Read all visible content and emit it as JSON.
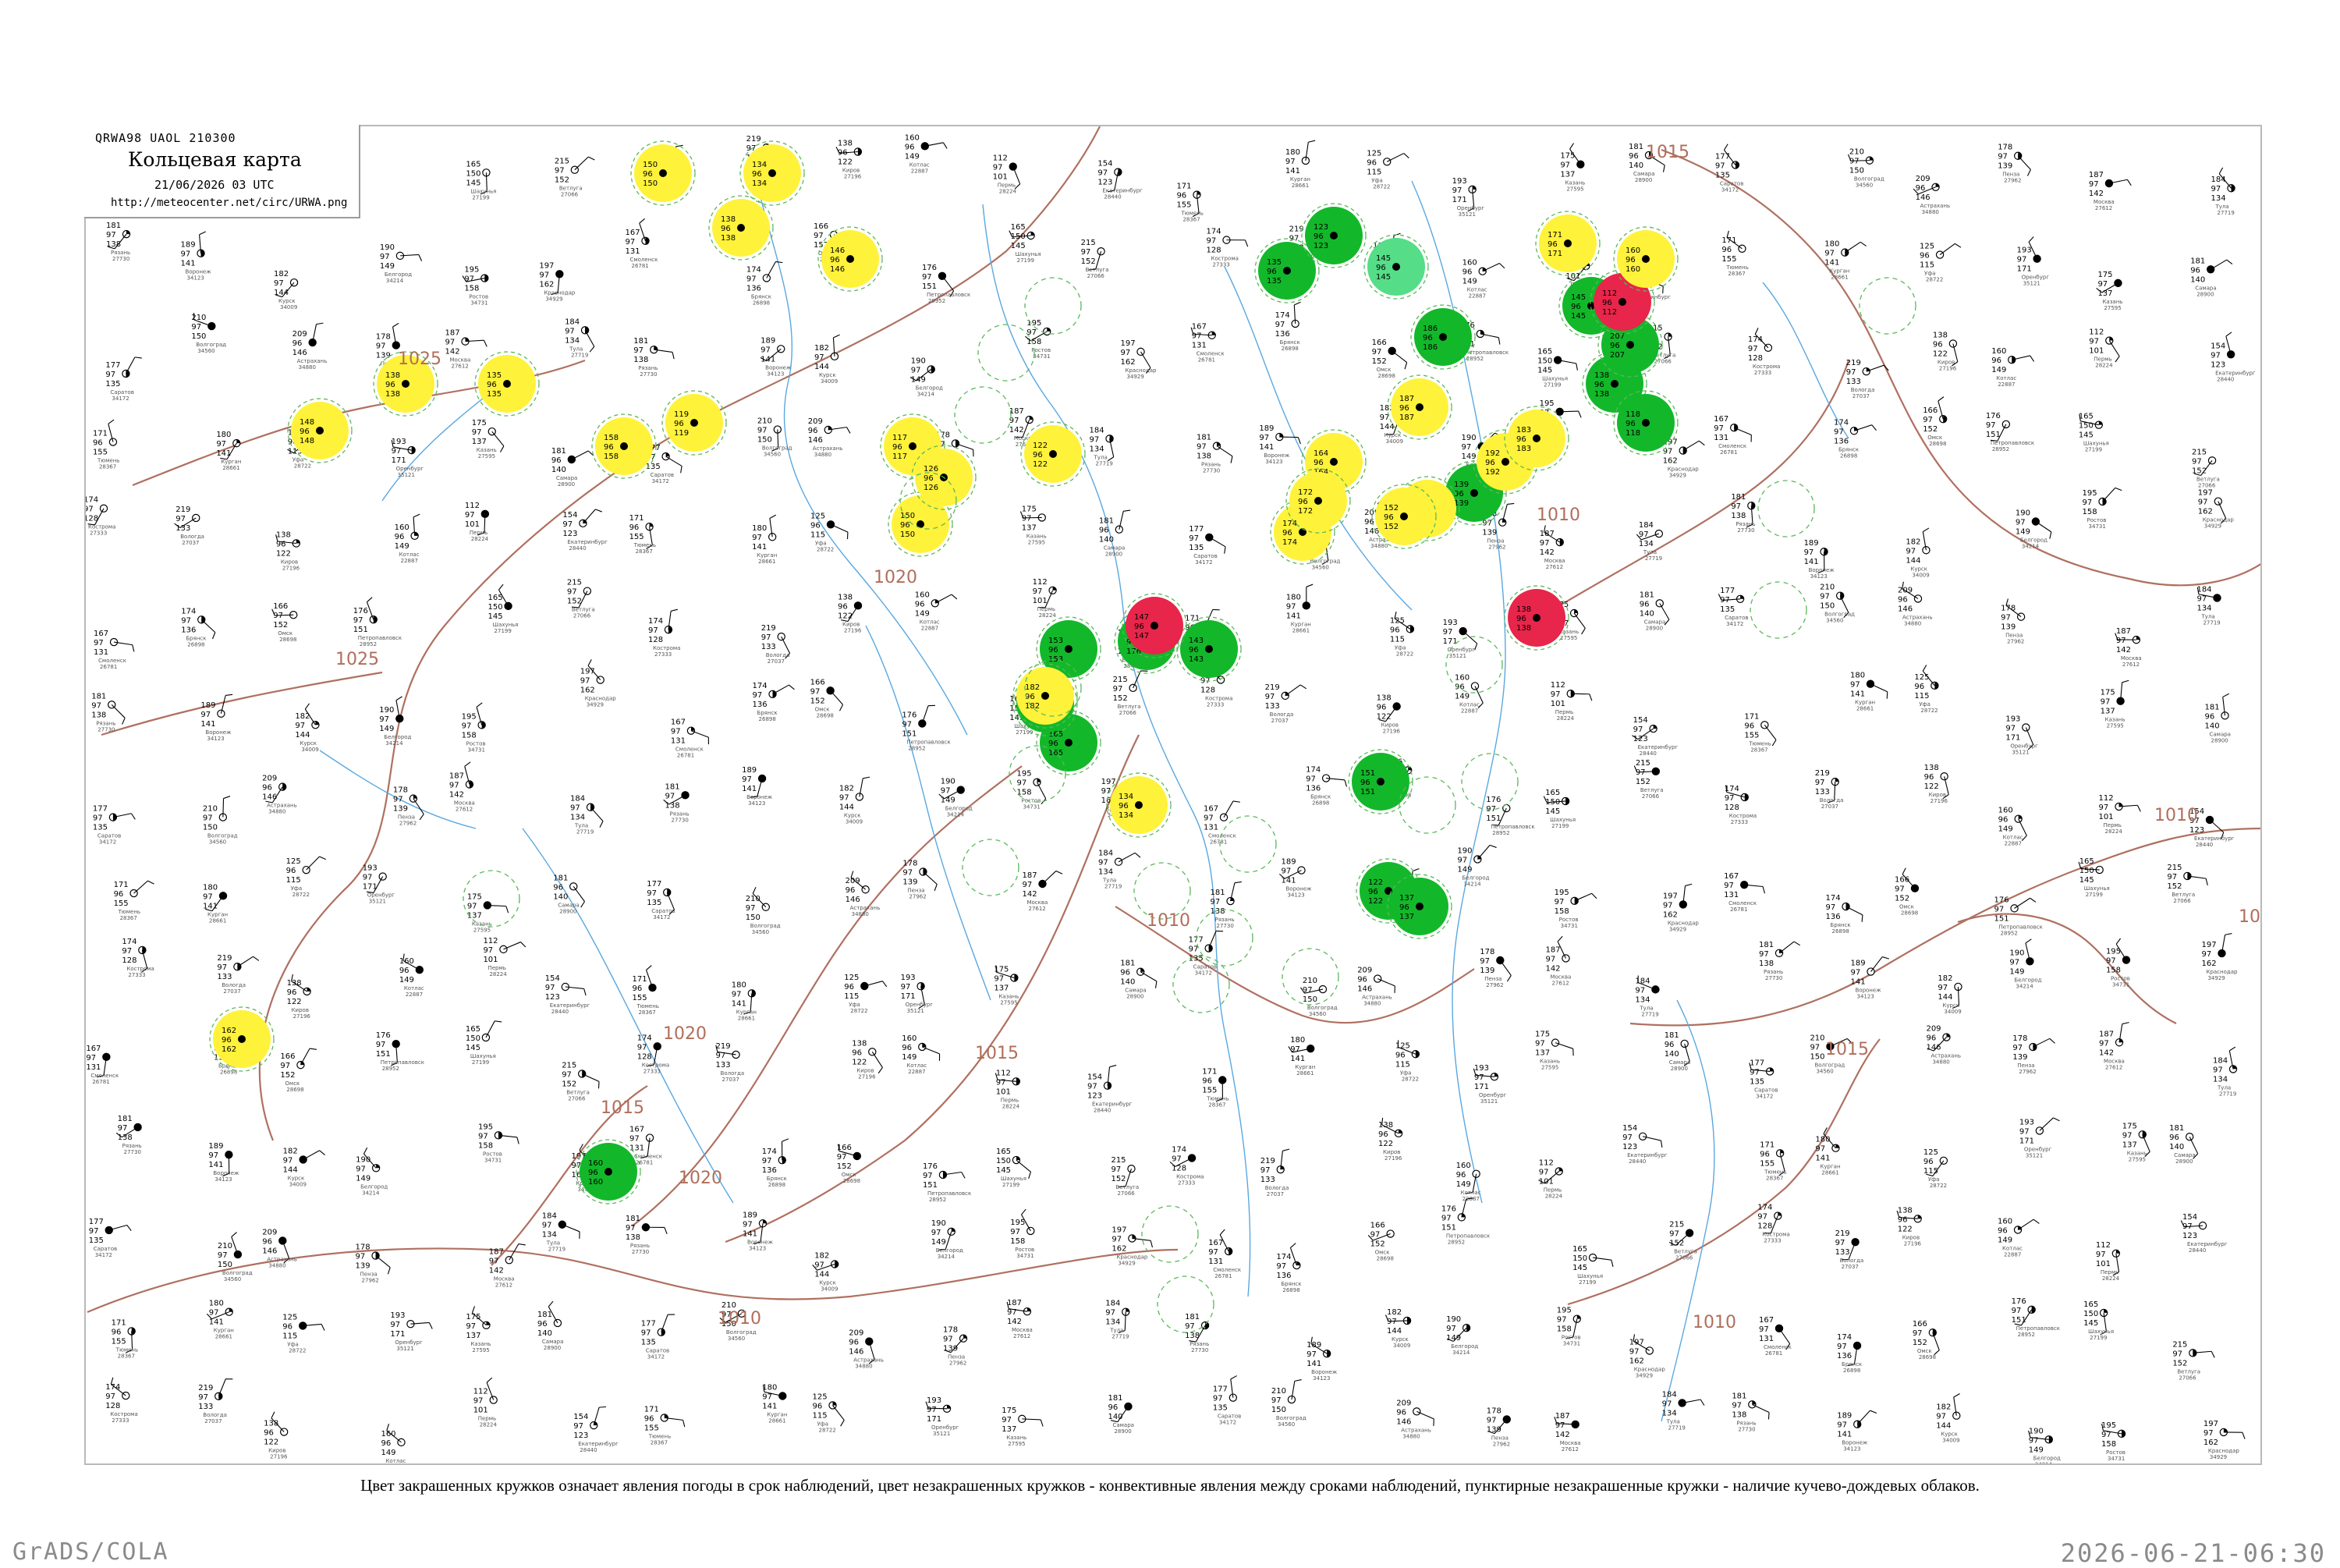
{
  "header": {
    "code": "QRWA98  UAOL  210300",
    "title": "Кольцевая карта",
    "datetime": "21/06/2026 03 UTC",
    "url": "http://meteocenter.net/circ/URWA.png"
  },
  "caption": "Цвет закрашенных кружков означает явления погоды в срок наблюдений, цвет незакрашенных кружков - конвективные явления между сроками наблюдений, пунктирные незакрашенные кружки - наличие кучево-дождевых облаков.",
  "footer": {
    "left": "GrADS/COLA",
    "right": "2026-06-21-06:30"
  },
  "colors": {
    "isobar": "#b07060",
    "river": "#5aa8e0",
    "rain": "#12b82a",
    "shower_yellow": "#fff23a",
    "thunder": "#e8254a",
    "drizzle": "#55dd88",
    "frame": "#b9b9b9"
  },
  "isobar_labels": [
    "1015",
    "1025",
    "1025",
    "1020",
    "1020",
    "1020",
    "1015",
    "1015",
    "1015",
    "1010",
    "1010",
    "1010",
    "1010",
    "1010",
    "1010"
  ],
  "stations": [
    {
      "name": "Шахунья",
      "id": "27199",
      "t": "165",
      "td": "150",
      "p": "145"
    },
    {
      "name": "Ветлуга",
      "id": "27066",
      "t": "215",
      "td": "97",
      "p": "152"
    },
    {
      "name": "Кострома",
      "id": "27333",
      "t": "174",
      "td": "97",
      "p": "128"
    },
    {
      "name": "Вологда",
      "id": "27037",
      "t": "219",
      "td": "97",
      "p": "133"
    },
    {
      "name": "Киров",
      "id": "27196",
      "t": "138",
      "td": "96",
      "p": "122"
    },
    {
      "name": "Котлас",
      "id": "22887",
      "t": "160",
      "td": "96",
      "p": "149"
    },
    {
      "name": "Пермь",
      "id": "28224",
      "t": "112",
      "td": "97",
      "p": "101"
    },
    {
      "name": "Екатеринбург",
      "id": "28440",
      "t": "154",
      "td": "97",
      "p": "123"
    },
    {
      "name": "Тюмень",
      "id": "28367",
      "t": "171",
      "td": "96",
      "p": "155"
    },
    {
      "name": "Курган",
      "id": "28661",
      "t": "180",
      "td": "97",
      "p": "141"
    },
    {
      "name": "Уфа",
      "id": "28722",
      "t": "125",
      "td": "96",
      "p": "115"
    },
    {
      "name": "Оренбург",
      "id": "35121",
      "t": "193",
      "td": "97",
      "p": "171"
    },
    {
      "name": "Казань",
      "id": "27595",
      "t": "175",
      "td": "97",
      "p": "137"
    },
    {
      "name": "Самара",
      "id": "28900",
      "t": "181",
      "td": "96",
      "p": "140"
    },
    {
      "name": "Саратов",
      "id": "34172",
      "t": "177",
      "td": "97",
      "p": "135"
    },
    {
      "name": "Волгоград",
      "id": "34560",
      "t": "210",
      "td": "97",
      "p": "150"
    },
    {
      "name": "Астрахань",
      "id": "34880",
      "t": "209",
      "td": "96",
      "p": "146"
    },
    {
      "name": "Пенза",
      "id": "27962",
      "t": "178",
      "td": "97",
      "p": "139"
    },
    {
      "name": "Москва",
      "id": "27612",
      "t": "187",
      "td": "97",
      "p": "142"
    },
    {
      "name": "Тула",
      "id": "27719",
      "t": "184",
      "td": "97",
      "p": "134"
    },
    {
      "name": "Рязань",
      "id": "27730",
      "t": "181",
      "td": "97",
      "p": "138"
    },
    {
      "name": "Воронеж",
      "id": "34123",
      "t": "189",
      "td": "97",
      "p": "141"
    },
    {
      "name": "Курск",
      "id": "34009",
      "t": "182",
      "td": "97",
      "p": "144"
    },
    {
      "name": "Белгород",
      "id": "34214",
      "t": "190",
      "td": "97",
      "p": "149"
    },
    {
      "name": "Ростов",
      "id": "34731",
      "t": "195",
      "td": "97",
      "p": "158"
    },
    {
      "name": "Краснодар",
      "id": "34929",
      "t": "197",
      "td": "97",
      "p": "162"
    },
    {
      "name": "Смоленск",
      "id": "26781",
      "t": "167",
      "td": "97",
      "p": "131"
    },
    {
      "name": "Брянск",
      "id": "26898",
      "t": "174",
      "td": "97",
      "p": "136"
    },
    {
      "name": "Омск",
      "id": "28698",
      "t": "166",
      "td": "97",
      "p": "152"
    },
    {
      "name": "Петропавловск",
      "id": "28952",
      "t": "176",
      "td": "97",
      "p": "151"
    }
  ],
  "weather_circles": [
    {
      "type": "rain",
      "label": "135 96 135"
    },
    {
      "type": "rain",
      "label": "123 96 123"
    },
    {
      "type": "rain",
      "label": "139 96 139"
    },
    {
      "type": "rain",
      "label": "145 96 145"
    },
    {
      "type": "rain",
      "label": "138 96 138"
    },
    {
      "type": "rain",
      "label": "118 96 118"
    },
    {
      "type": "rain",
      "label": "153 96 153"
    },
    {
      "type": "rain",
      "label": "176 96 176"
    },
    {
      "type": "rain",
      "label": "143 96 143"
    },
    {
      "type": "rain",
      "label": "165 96 165"
    },
    {
      "type": "rain",
      "label": "151 96 151"
    },
    {
      "type": "rain",
      "label": "122 96 122"
    },
    {
      "type": "rain",
      "label": "137 96 137"
    },
    {
      "type": "rain",
      "label": "147 96 147"
    },
    {
      "type": "rain",
      "label": "160 96 160"
    },
    {
      "type": "rain",
      "label": "186 96 186"
    },
    {
      "type": "rain",
      "label": "207 96 207"
    },
    {
      "type": "thunder",
      "label": "112 96 112"
    },
    {
      "type": "thunder",
      "label": "138 96 138"
    },
    {
      "type": "thunder",
      "label": "147 96 147"
    },
    {
      "type": "drizzle",
      "label": "145 96 145"
    },
    {
      "type": "shower",
      "label": "150 96 150"
    },
    {
      "type": "shower",
      "label": "138 96 138"
    },
    {
      "type": "shower",
      "label": "134 96 134"
    },
    {
      "type": "shower",
      "label": "146 96 146"
    },
    {
      "type": "shower",
      "label": "138 96 138"
    },
    {
      "type": "shower",
      "label": "135 96 135"
    },
    {
      "type": "shower",
      "label": "148 96 148"
    },
    {
      "type": "shower",
      "label": "119 96 119"
    },
    {
      "type": "shower",
      "label": "158 96 158"
    },
    {
      "type": "shower",
      "label": "117 96 117"
    },
    {
      "type": "shower",
      "label": "150 96 150"
    },
    {
      "type": "shower",
      "label": "126 96 126"
    },
    {
      "type": "shower",
      "label": "122 96 122"
    },
    {
      "type": "shower",
      "label": "182 96 182"
    },
    {
      "type": "shower",
      "label": "174 96 174"
    },
    {
      "type": "shower",
      "label": "164 96 164"
    },
    {
      "type": "shower",
      "label": "172 96 172"
    },
    {
      "type": "shower",
      "label": "149 96 149"
    },
    {
      "type": "shower",
      "label": "152 96 152"
    },
    {
      "type": "shower",
      "label": "192 96 192"
    },
    {
      "type": "shower",
      "label": "171 96 171"
    },
    {
      "type": "shower",
      "label": "160 96 160"
    },
    {
      "type": "shower",
      "label": "183 96 183"
    },
    {
      "type": "shower",
      "label": "134 96 134"
    },
    {
      "type": "shower",
      "label": "162 96 162"
    },
    {
      "type": "shower",
      "label": "187 96 187"
    }
  ]
}
